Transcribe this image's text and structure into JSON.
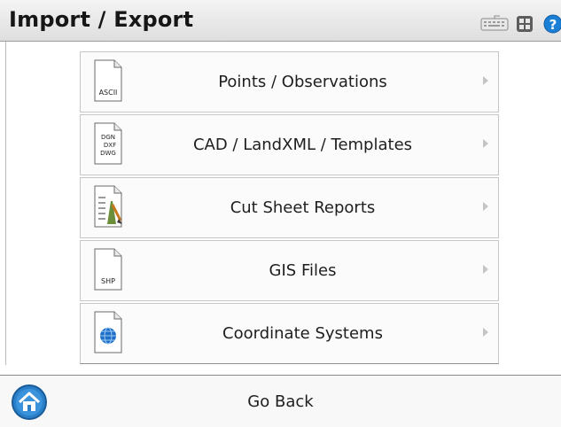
{
  "header": {
    "title": "Import / Export",
    "icons": [
      "keyboard-icon",
      "applications-icon",
      "help-icon"
    ]
  },
  "menu": {
    "items": [
      {
        "label": "Points / Observations",
        "icon": "ascii-file-icon",
        "icon_text": "ASCII"
      },
      {
        "label": "CAD / LandXML / Templates",
        "icon": "cad-file-icon",
        "icon_text": "DGN DXF DWG"
      },
      {
        "label": "Cut Sheet Reports",
        "icon": "report-file-icon"
      },
      {
        "label": "GIS Files",
        "icon": "shp-file-icon",
        "icon_text": "SHP"
      },
      {
        "label": "Coordinate Systems",
        "icon": "globe-file-icon"
      }
    ]
  },
  "footer": {
    "go_back_label": "Go Back",
    "icon": "home-icon"
  },
  "colors": {
    "help": "#1c7fd6",
    "globe": "#1e6fc8",
    "home": "#2a7fc9"
  }
}
